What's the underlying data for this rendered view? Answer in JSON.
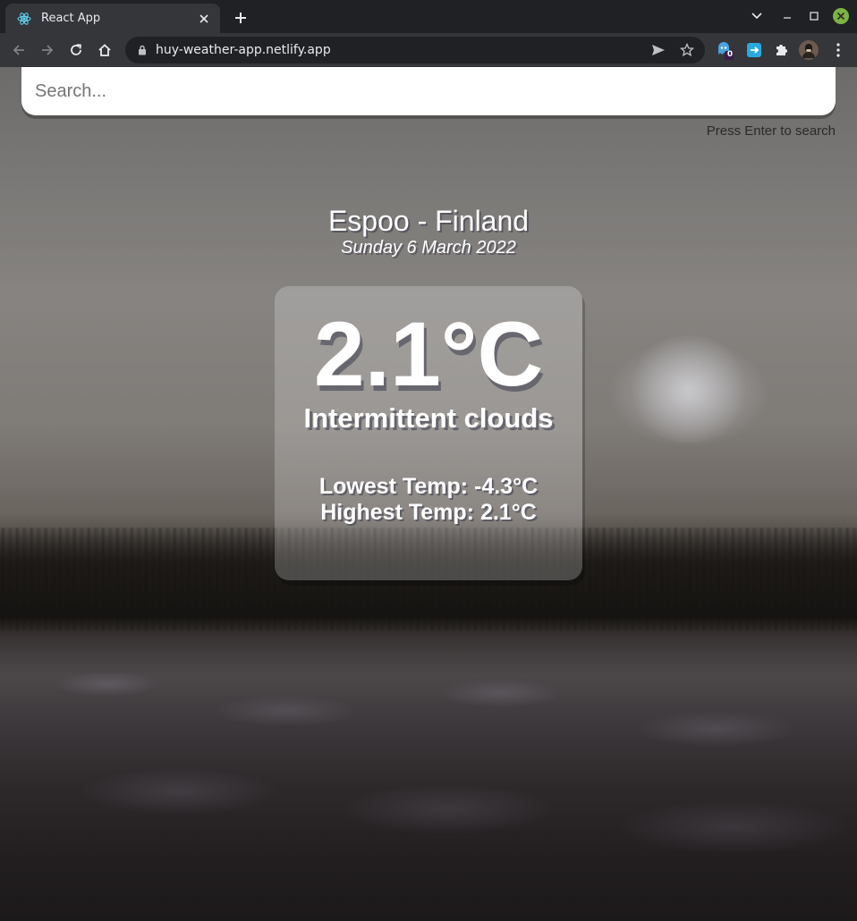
{
  "browser": {
    "tab_title": "React App",
    "url": "huy-weather-app.netlify.app",
    "extension_badge": "0"
  },
  "search": {
    "placeholder": "Search...",
    "value": "",
    "hint": "Press Enter to search"
  },
  "location": {
    "city_country": "Espoo - Finland",
    "date": "Sunday 6 March 2022"
  },
  "weather": {
    "temperature": "2.1°C",
    "description": "Intermittent clouds",
    "lowest": "Lowest Temp: -4.3°C",
    "highest": "Highest Temp: 2.1°C"
  },
  "colors": {
    "chrome_dark": "#202124",
    "chrome_toolbar": "#35363a",
    "react_blue": "#61dafb",
    "close_green": "#7cb342"
  }
}
